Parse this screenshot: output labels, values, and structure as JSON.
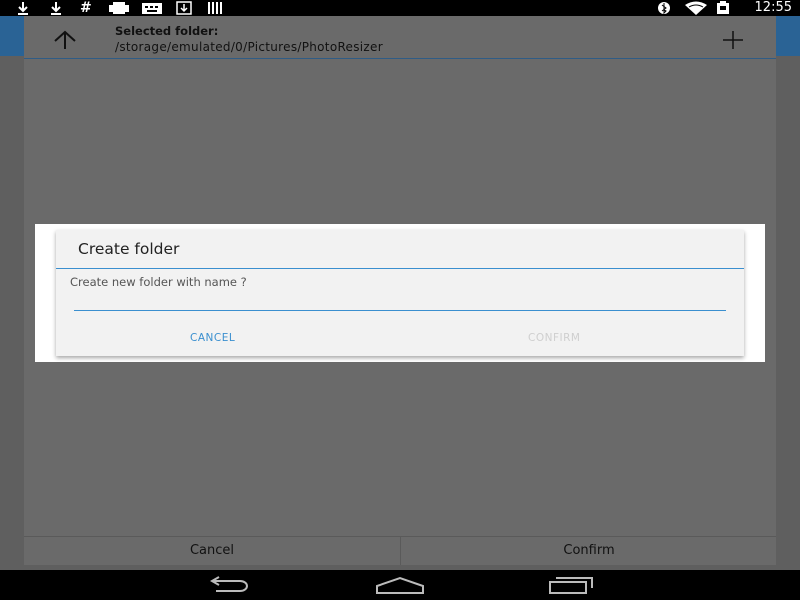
{
  "status_bar": {
    "time": "12:55",
    "left_icons": [
      "download-icon",
      "download-icon",
      "hash-icon",
      "print-icon",
      "keyboard-icon",
      "save-icon",
      "barcode-icon"
    ],
    "right_icons": [
      "bluetooth-icon",
      "wifi-icon",
      "battery-icon"
    ]
  },
  "chooser": {
    "selected_label": "Selected folder:",
    "selected_path": "/storage/emulated/0/Pictures/PhotoResizer",
    "cancel_label": "Cancel",
    "confirm_label": "Confirm"
  },
  "create_dialog": {
    "title": "Create folder",
    "prompt": "Create new folder with name ?",
    "input_value": "",
    "cancel_label": "CANCEL",
    "confirm_label": "CONFIRM"
  },
  "colors": {
    "accent": "#3a8fcf",
    "app_bar": "#2a6395",
    "dim_background": "#5f5f5f"
  },
  "nav_bar": {
    "icons": [
      "back-icon",
      "home-icon",
      "recents-icon"
    ]
  }
}
